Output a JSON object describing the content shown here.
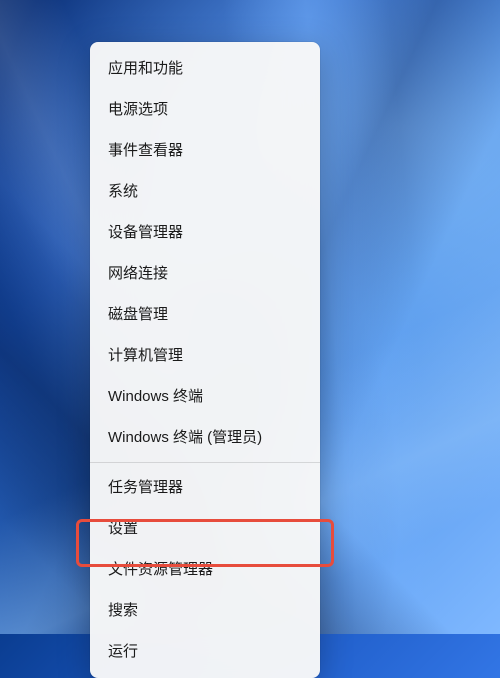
{
  "menu": {
    "items": [
      {
        "label": "应用和功能"
      },
      {
        "label": "电源选项"
      },
      {
        "label": "事件查看器"
      },
      {
        "label": "系统"
      },
      {
        "label": "设备管理器"
      },
      {
        "label": "网络连接"
      },
      {
        "label": "磁盘管理"
      },
      {
        "label": "计算机管理"
      },
      {
        "label": "Windows 终端"
      },
      {
        "label": "Windows 终端 (管理员)"
      }
    ],
    "items2": [
      {
        "label": "任务管理器"
      },
      {
        "label": "设置"
      },
      {
        "label": "文件资源管理器"
      },
      {
        "label": "搜索"
      },
      {
        "label": "运行"
      }
    ]
  },
  "highlight_color": "#e74c3c"
}
